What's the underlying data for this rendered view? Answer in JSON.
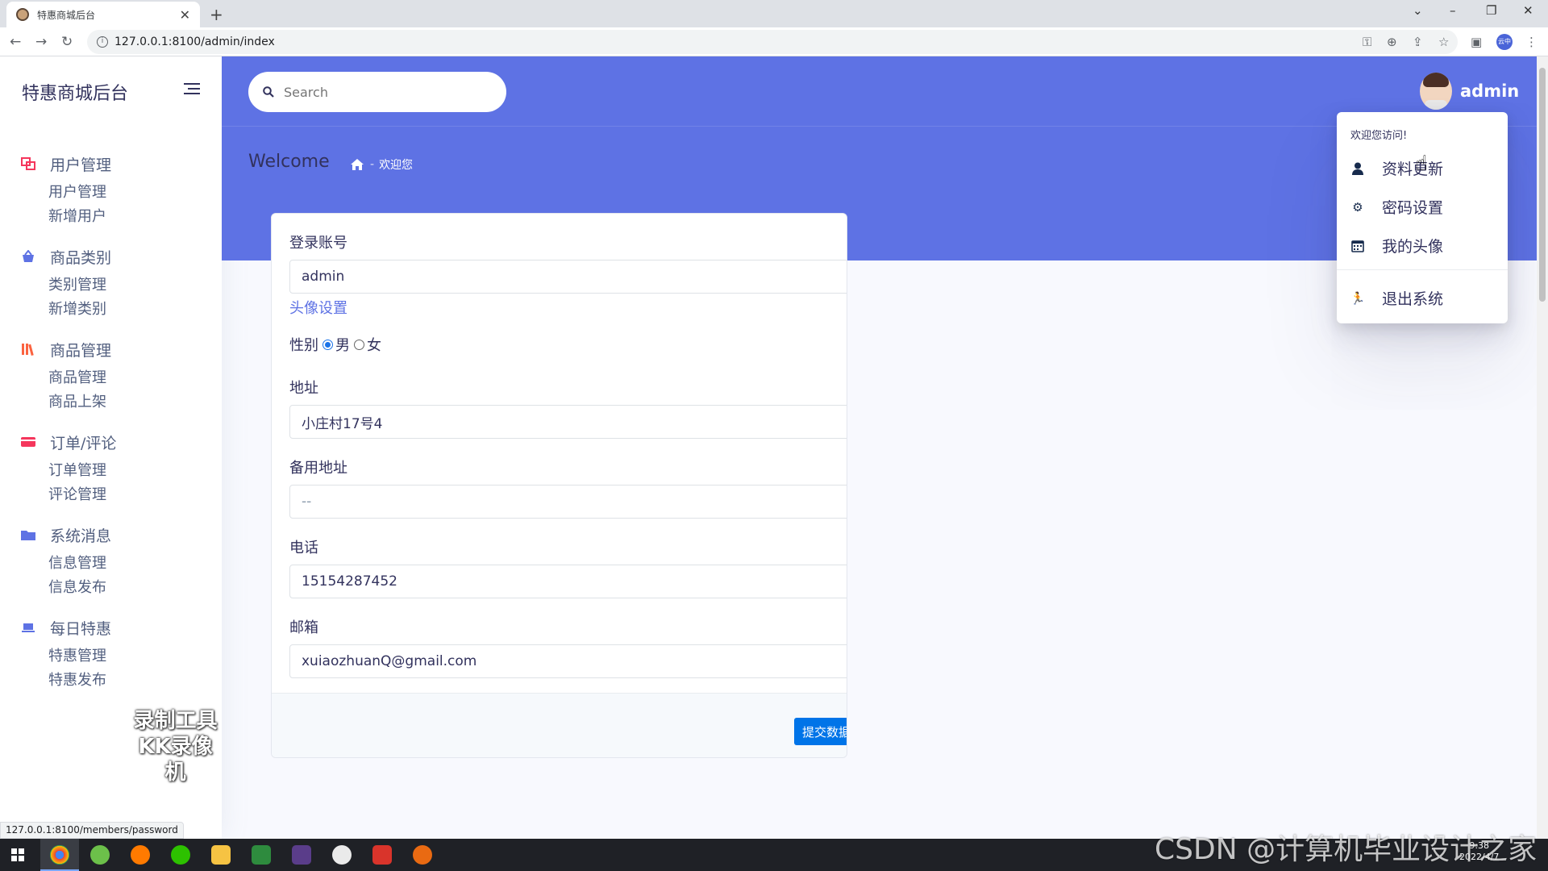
{
  "browser": {
    "tab_title": "特惠商城后台",
    "url": "127.0.0.1:8100/admin/index",
    "status_url": "127.0.0.1:8100/members/password",
    "profile_label": "云中"
  },
  "sidebar": {
    "brand": "特惠商城后台",
    "groups": [
      {
        "label": "用户管理",
        "icon": "users-icon",
        "color": "#f5365c",
        "items": [
          "用户管理",
          "新增用户"
        ]
      },
      {
        "label": "商品类别",
        "icon": "basket-icon",
        "color": "#5e72e4",
        "items": [
          "类别管理",
          "新增类别"
        ]
      },
      {
        "label": "商品管理",
        "icon": "books-icon",
        "color": "#fb6340",
        "items": [
          "商品管理",
          "商品上架"
        ]
      },
      {
        "label": "订单/评论",
        "icon": "credit-card-icon",
        "color": "#f5365c",
        "items": [
          "订单管理",
          "评论管理"
        ]
      },
      {
        "label": "系统消息",
        "icon": "folder-icon",
        "color": "#5e72e4",
        "items": [
          "信息管理",
          "信息发布"
        ]
      },
      {
        "label": "每日特惠",
        "icon": "laptop-icon",
        "color": "#5e72e4",
        "items": [
          "特惠管理",
          "特惠发布"
        ]
      }
    ],
    "watermark_line1": "录制工具",
    "watermark_line2": "KK录像机"
  },
  "header": {
    "search_placeholder": "Search",
    "username": "admin",
    "page_title": "Welcome",
    "breadcrumb": "欢迎您",
    "bg_color": "#5e72e4"
  },
  "form": {
    "account_label": "登录账号",
    "account_value": "admin",
    "avatar_link": "头像设置",
    "gender_label": "性别",
    "gender_male": "男",
    "gender_female": "女",
    "gender_selected": "男",
    "address_label": "地址",
    "address_value": "小庄村17号4",
    "alt_address_label": "备用地址",
    "alt_address_value": "--",
    "phone_label": "电话",
    "phone_value": "15154287452",
    "email_label": "邮箱",
    "email_value": "xuiaozhuanQ@gmail.com",
    "submit_label": "提交数据"
  },
  "dropdown": {
    "heading": "欢迎您访问!",
    "items": [
      {
        "label": "资料更新",
        "icon": "user-icon"
      },
      {
        "label": "密码设置",
        "icon": "gear-icon"
      },
      {
        "label": "我的头像",
        "icon": "calendar-icon"
      },
      {
        "label": "退出系统",
        "icon": "running-icon"
      }
    ]
  },
  "taskbar": {
    "time": "9:38",
    "date": "2022/4/7",
    "overlay_text": "CSDN @计算机毕业设计之家"
  }
}
